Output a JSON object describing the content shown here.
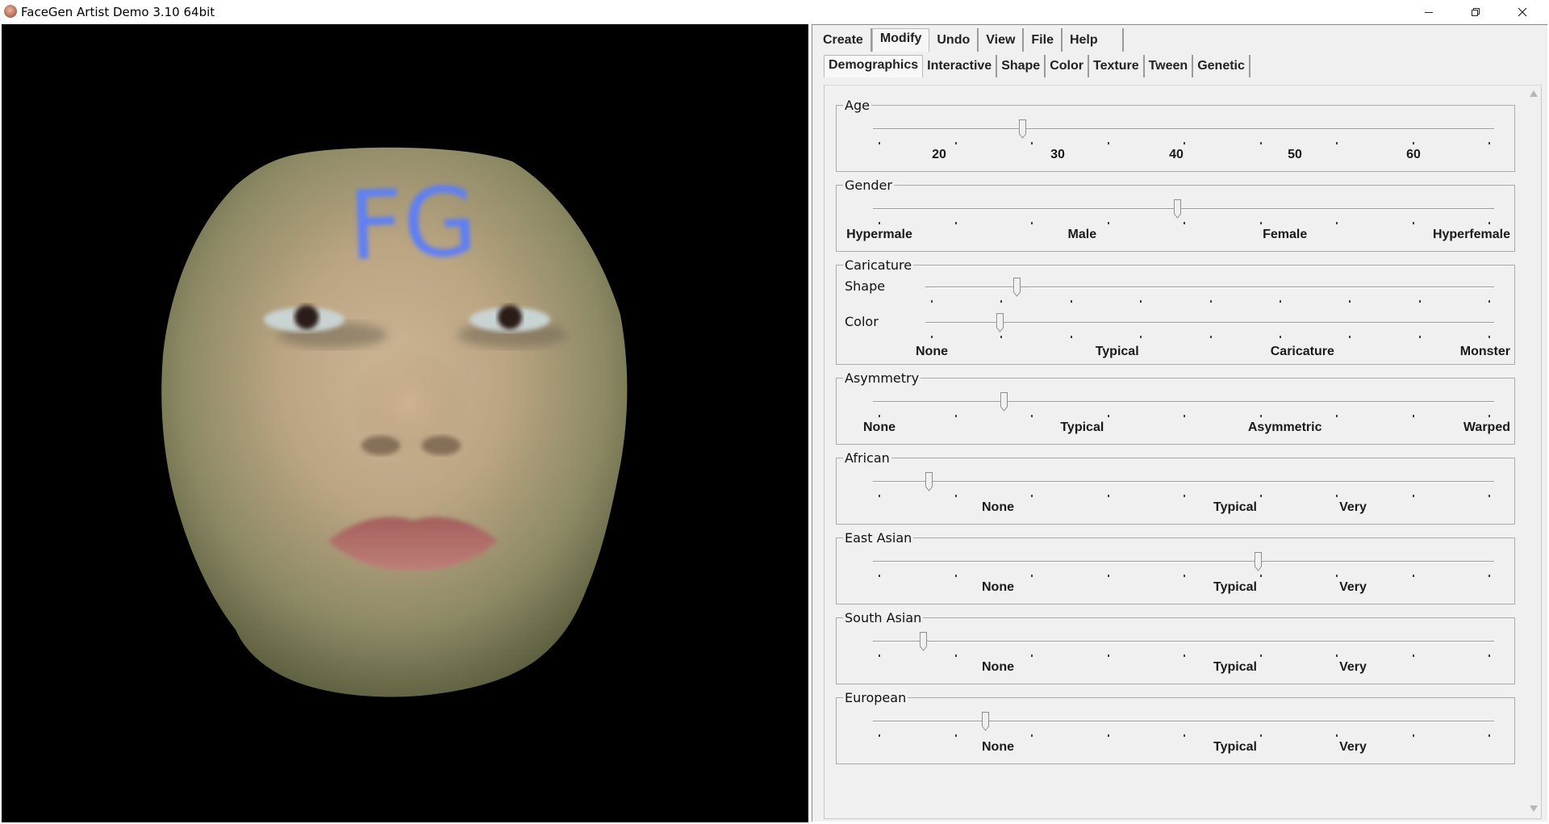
{
  "window": {
    "title": "FaceGen Artist Demo 3.10 64bit",
    "minimize_icon": "minimize-icon",
    "maximize_icon": "restore-icon",
    "close_icon": "close-icon"
  },
  "viewport": {
    "forehead_text": "FG",
    "forehead_text_color": "#5f7ff5"
  },
  "menu": {
    "items": [
      "Create",
      "Modify",
      "Undo",
      "View",
      "File",
      "Help"
    ],
    "active": "Modify"
  },
  "subtabs": {
    "items": [
      "Demographics",
      "Interactive",
      "Shape",
      "Color",
      "Texture",
      "Tween",
      "Genetic"
    ],
    "active": "Demographics"
  },
  "groups": [
    {
      "title": "Age",
      "sliders": [
        {
          "label": "",
          "value": 0.24
        }
      ],
      "labels": [
        "20",
        "30",
        "40",
        "50",
        "60"
      ]
    },
    {
      "title": "Gender",
      "sliders": [
        {
          "label": "",
          "value": 0.49
        }
      ],
      "labels": [
        "Hypermale",
        "Male",
        "Female",
        "Hyperfemale"
      ]
    },
    {
      "title": "Caricature",
      "sliders": [
        {
          "label": "Shape",
          "value": 0.16
        },
        {
          "label": "Color",
          "value": 0.13
        }
      ],
      "labels": [
        "None",
        "Typical",
        "Caricature",
        "Monster"
      ]
    },
    {
      "title": "Asymmetry",
      "sliders": [
        {
          "label": "",
          "value": 0.21
        }
      ],
      "labels": [
        "None",
        "Typical",
        "Asymmetric",
        "Warped"
      ]
    },
    {
      "title": "African",
      "sliders": [
        {
          "label": "",
          "value": 0.09
        }
      ],
      "labels": [
        "None",
        "Typical",
        "Very"
      ]
    },
    {
      "title": "East Asian",
      "sliders": [
        {
          "label": "",
          "value": 0.62
        }
      ],
      "labels": [
        "None",
        "Typical",
        "Very"
      ]
    },
    {
      "title": "South Asian",
      "sliders": [
        {
          "label": "",
          "value": 0.08
        }
      ],
      "labels": [
        "None",
        "Typical",
        "Very"
      ]
    },
    {
      "title": "European",
      "sliders": [
        {
          "label": "",
          "value": 0.18
        }
      ],
      "labels": [
        "None",
        "Typical",
        "Very"
      ]
    }
  ]
}
